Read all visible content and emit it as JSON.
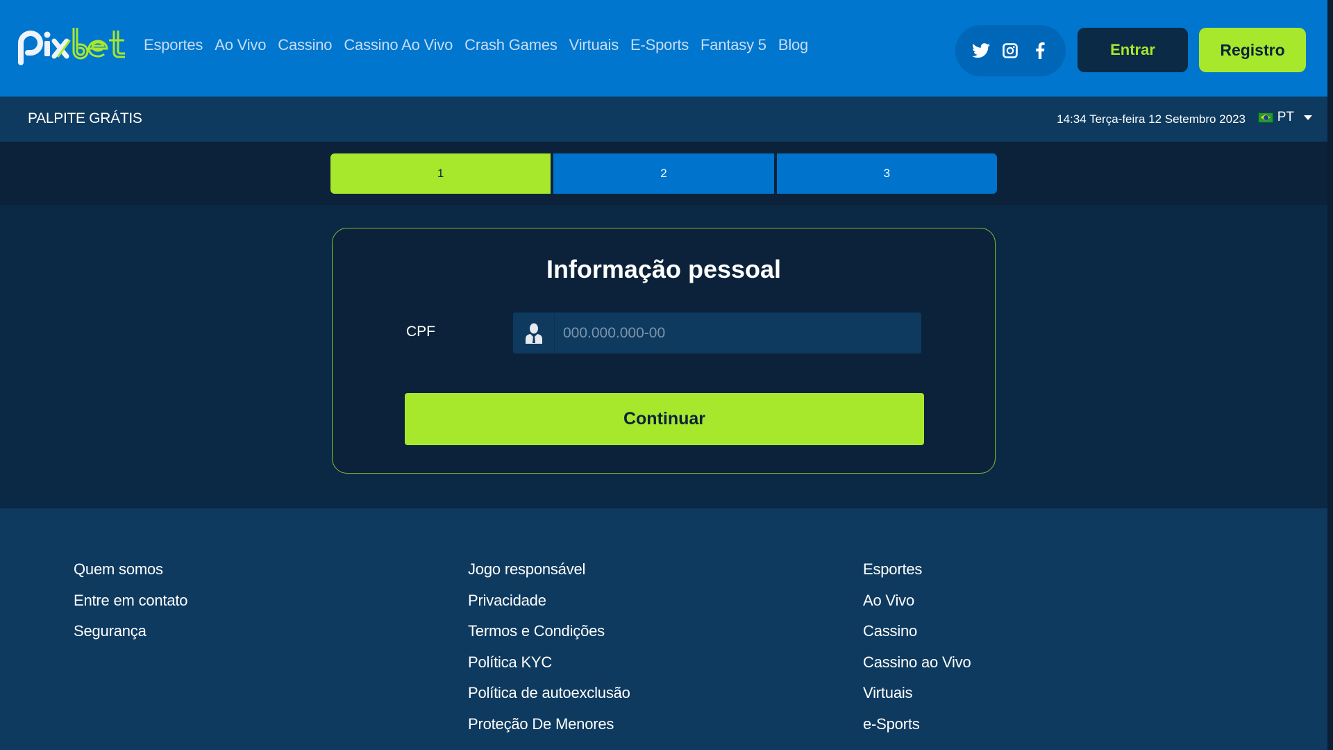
{
  "brand": {
    "name_part1": "pix",
    "name_part2": "bet",
    "accent": "#a8e82c",
    "primary": "#0076ce"
  },
  "nav": {
    "items": [
      {
        "label": "Esportes"
      },
      {
        "label": "Ao Vivo"
      },
      {
        "label": "Cassino"
      },
      {
        "label": "Cassino Ao Vivo"
      },
      {
        "label": "Crash Games"
      },
      {
        "label": "Virtuais"
      },
      {
        "label": "E-Sports"
      },
      {
        "label": "Fantasy 5"
      },
      {
        "label": "Blog"
      }
    ]
  },
  "social": {
    "icons": [
      "twitter-icon",
      "instagram-icon",
      "facebook-icon"
    ]
  },
  "auth": {
    "login_label": "Entrar",
    "register_label": "Registro"
  },
  "subbar": {
    "title": "PALPITE GRÁTIS",
    "datetime": "14:34 Terça-feira 12 Setembro 2023",
    "language": "PT"
  },
  "steps": {
    "items": [
      {
        "label": "1",
        "active": true
      },
      {
        "label": "2",
        "active": false
      },
      {
        "label": "3",
        "active": false
      }
    ]
  },
  "form": {
    "title": "Informação pessoal",
    "cpf_label": "CPF",
    "cpf_placeholder": "000.000.000-00",
    "cpf_value": "",
    "submit_label": "Continuar"
  },
  "footer": {
    "col1": [
      "Quem somos",
      "Entre em contato",
      "Segurança"
    ],
    "col2": [
      "Jogo responsável",
      "Privacidade",
      "Termos e Condições",
      "Política KYC",
      "Política de autoexclusão",
      "Proteção De Menores"
    ],
    "col3": [
      "Esportes",
      "Ao Vivo",
      "Cassino",
      "Cassino ao Vivo",
      "Virtuais",
      "e-Sports"
    ]
  }
}
